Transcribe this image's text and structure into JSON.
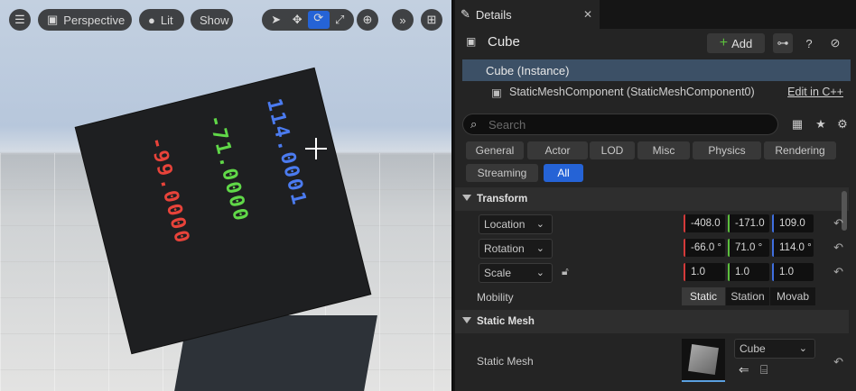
{
  "viewport": {
    "perspective_label": "Perspective",
    "lit_label": "Lit",
    "show_label": "Show",
    "cube_text": {
      "red": "-99.0000",
      "green": "-71.0000",
      "blue": "114.0001"
    },
    "colors": {
      "red": "#e8433a",
      "green": "#60d848",
      "blue": "#4b7bf0"
    }
  },
  "panel": {
    "tab_label": "Details",
    "title": "Cube",
    "add_label": "Add",
    "tree": {
      "instance": "Cube (Instance)",
      "component": "StaticMeshComponent (StaticMeshComponent0)",
      "edit_link": "Edit in C++"
    },
    "search_placeholder": "Search",
    "categories": [
      "General",
      "Actor",
      "LOD",
      "Misc",
      "Physics",
      "Rendering",
      "Streaming",
      "All"
    ],
    "selected_category": "All",
    "transform": {
      "section": "Transform",
      "location": {
        "label": "Location",
        "x": "-408.0",
        "y": "-171.0",
        "z": "109.0"
      },
      "rotation": {
        "label": "Rotation",
        "x": "-66.0 °",
        "y": "71.0 °",
        "z": "114.0 °"
      },
      "scale": {
        "label": "Scale",
        "x": "1.0",
        "y": "1.0",
        "z": "1.0"
      },
      "mobility": {
        "label": "Mobility",
        "options": [
          "Static",
          "Station",
          "Movab"
        ],
        "selected": "Static"
      }
    },
    "static_mesh": {
      "section": "Static Mesh",
      "label": "Static Mesh",
      "value": "Cube"
    }
  }
}
